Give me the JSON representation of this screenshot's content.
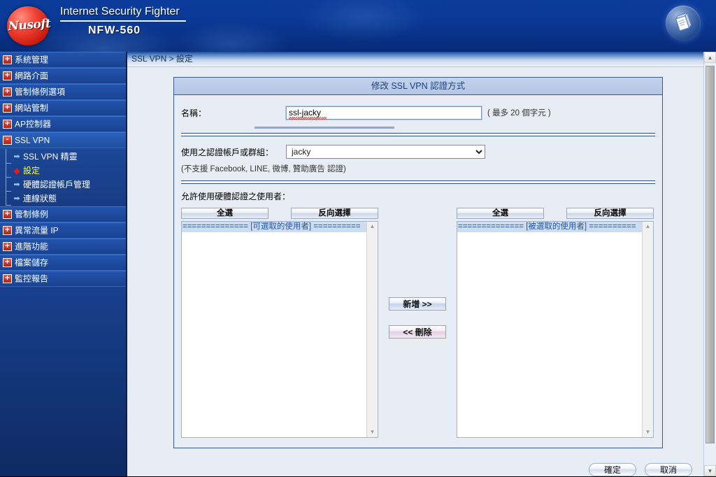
{
  "header": {
    "brand_line1": "Internet Security Fighter",
    "brand_line2": "NFW-560",
    "logo_text": "Nusoft",
    "help_icon": "manual-book-icon"
  },
  "sidebar": {
    "items": [
      {
        "label": "系統管理",
        "state": "collapsed",
        "marker": "+"
      },
      {
        "label": "網路介面",
        "state": "collapsed",
        "marker": "+"
      },
      {
        "label": "管制條例選項",
        "state": "collapsed",
        "marker": "+"
      },
      {
        "label": "網站管制",
        "state": "collapsed",
        "marker": "+"
      },
      {
        "label": "AP控制器",
        "state": "collapsed",
        "marker": "+"
      },
      {
        "label": "SSL VPN",
        "state": "expanded",
        "marker": "-"
      },
      {
        "label": "管制條例",
        "state": "collapsed",
        "marker": "+"
      },
      {
        "label": "異常流量 IP",
        "state": "collapsed",
        "marker": "+"
      },
      {
        "label": "進階功能",
        "state": "collapsed",
        "marker": "+"
      },
      {
        "label": "檔案儲存",
        "state": "collapsed",
        "marker": "+"
      },
      {
        "label": "監控報告",
        "state": "collapsed",
        "marker": "+"
      }
    ],
    "sub_items": [
      {
        "label": "SSL VPN 精靈",
        "active": false,
        "bullet": "➡"
      },
      {
        "label": "設定",
        "active": true,
        "bullet": "◆"
      },
      {
        "label": "硬體認證帳戶管理",
        "active": false,
        "bullet": "➡"
      },
      {
        "label": "連線狀態",
        "active": false,
        "bullet": "➡"
      }
    ]
  },
  "breadcrumb": "SSL VPN > 設定",
  "panel": {
    "title": "修改 SSL VPN 認證方式",
    "name_label": "名稱：",
    "name_value": "ssl-jacky",
    "name_hint": "( 最多 20 個字元 )",
    "account_label": "使用之認證帳戶或群組：",
    "account_value": "jacky",
    "account_options": [
      "jacky"
    ],
    "account_note": "(不支援 Facebook, LINE, 微博, 贊助廣告 認證)",
    "hw_users_label": "允許使用硬體認證之使用者："
  },
  "dual_list": {
    "left": {
      "select_all_label": "全選",
      "invert_label": "反向選擇",
      "header": "============== [可選取的使用者] ==========",
      "items": []
    },
    "right": {
      "select_all_label": "全選",
      "invert_label": "反向選擇",
      "header": "============== [被選取的使用者] ==========",
      "items": []
    },
    "add_label": "新增 >>",
    "remove_label": "<< 刪除"
  },
  "footer": {
    "ok_label": "確定",
    "cancel_label": "取消"
  },
  "colors": {
    "header_blue": "#0a3896",
    "sidebar_blue": "#18408d",
    "panel_header": "#b3c6e4",
    "content_bg": "#e8ecf5",
    "active_item": "#ffff3b",
    "active_bullet": "#e41b14"
  }
}
